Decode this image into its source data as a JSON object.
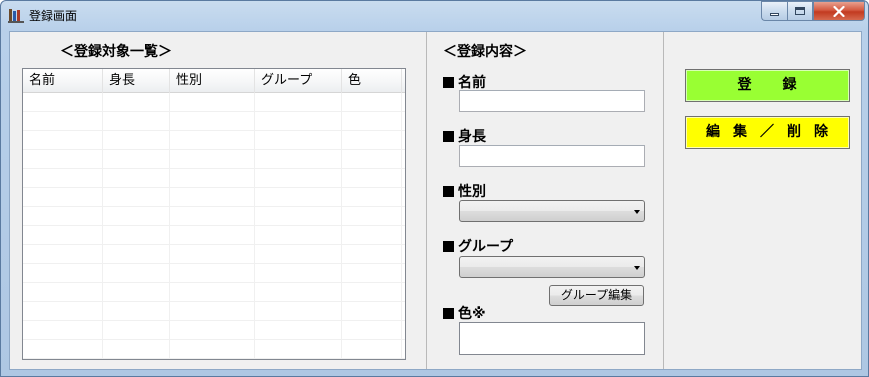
{
  "window": {
    "title": "登録画面"
  },
  "list_panel": {
    "title": "＜登録対象一覧＞",
    "columns": [
      "名前",
      "身長",
      "性別",
      "グループ",
      "色"
    ],
    "rows": [
      [
        "",
        "",
        "",
        "",
        ""
      ],
      [
        "",
        "",
        "",
        "",
        ""
      ],
      [
        "",
        "",
        "",
        "",
        ""
      ],
      [
        "",
        "",
        "",
        "",
        ""
      ],
      [
        "",
        "",
        "",
        "",
        ""
      ],
      [
        "",
        "",
        "",
        "",
        ""
      ],
      [
        "",
        "",
        "",
        "",
        ""
      ],
      [
        "",
        "",
        "",
        "",
        ""
      ],
      [
        "",
        "",
        "",
        "",
        ""
      ],
      [
        "",
        "",
        "",
        "",
        ""
      ],
      [
        "",
        "",
        "",
        "",
        ""
      ],
      [
        "",
        "",
        "",
        "",
        ""
      ],
      [
        "",
        "",
        "",
        "",
        ""
      ],
      [
        "",
        "",
        "",
        "",
        ""
      ]
    ]
  },
  "detail_panel": {
    "title": "＜登録内容＞",
    "name": {
      "label": "名前",
      "value": ""
    },
    "height": {
      "label": "身長",
      "value": ""
    },
    "gender": {
      "label": "性別",
      "selected": ""
    },
    "group": {
      "label": "グループ",
      "selected": ""
    },
    "group_edit_button": "グループ編集",
    "color": {
      "label": "色※"
    }
  },
  "actions": {
    "register": [
      "登",
      "録"
    ],
    "edit_delete": [
      "編",
      "集",
      "／",
      "削",
      "除"
    ]
  },
  "colors": {
    "register_button": "#99ff33",
    "edit_delete_button": "#ffff00"
  }
}
